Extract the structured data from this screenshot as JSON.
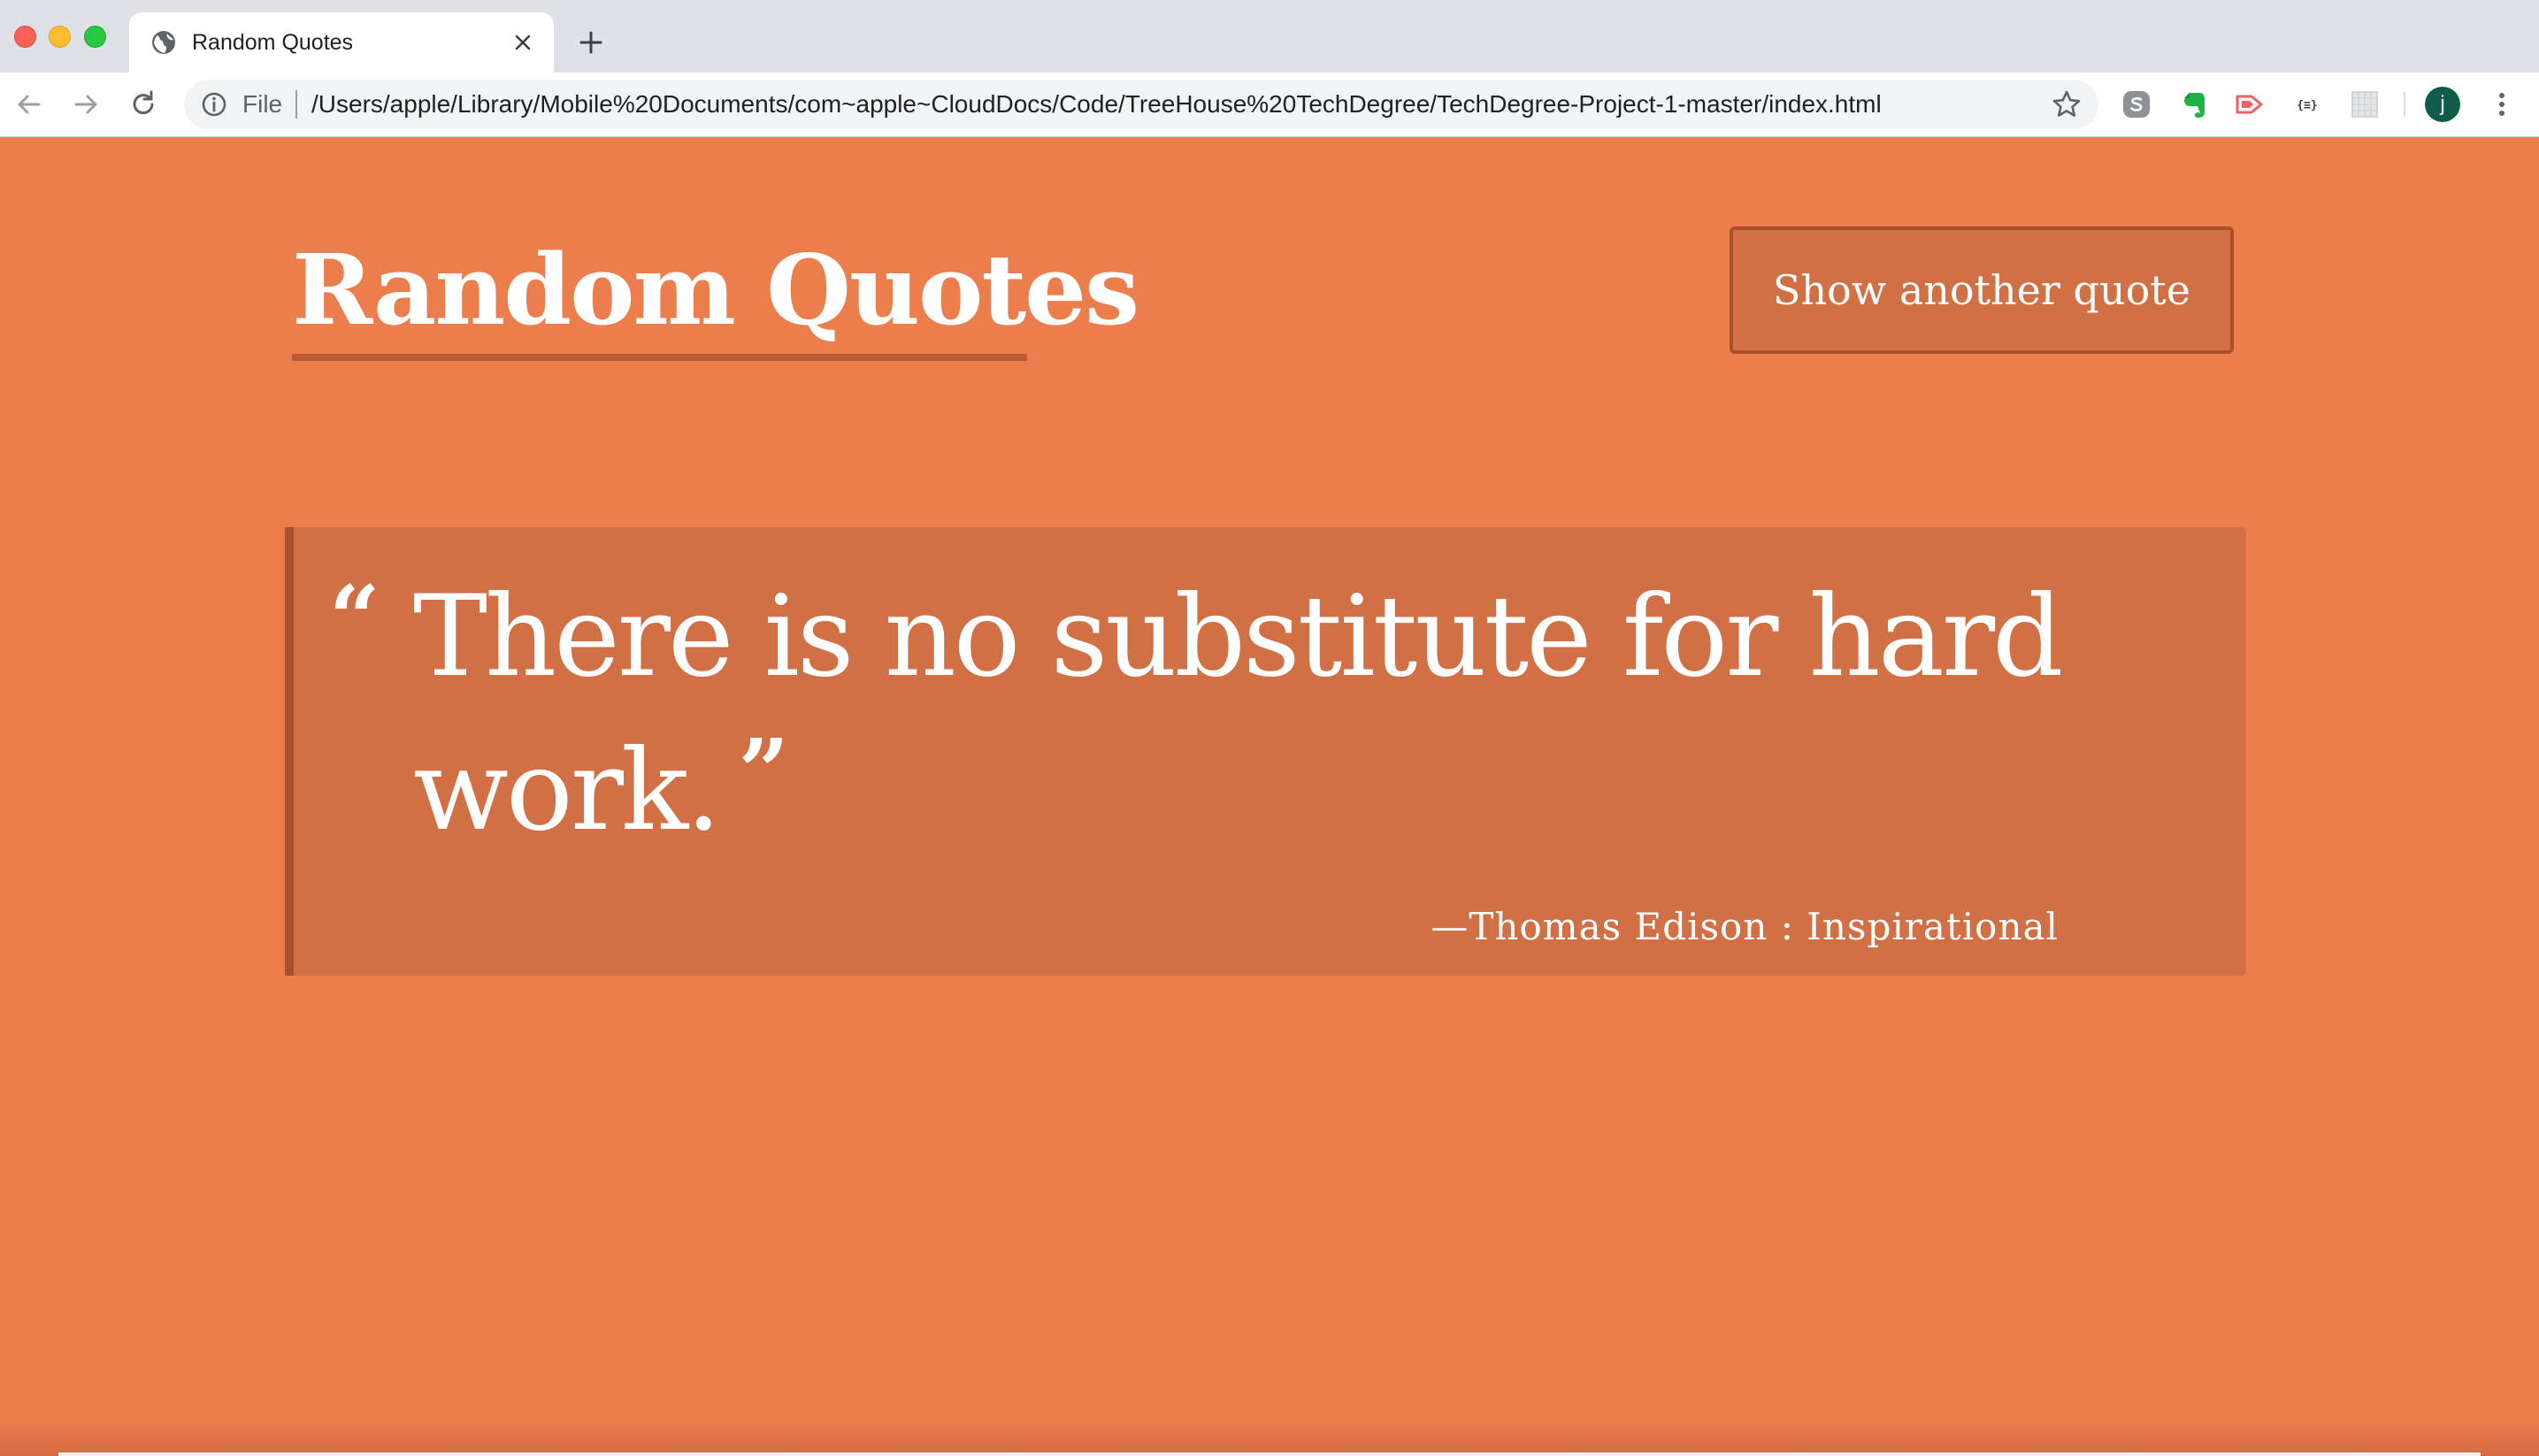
{
  "browser": {
    "tab": {
      "title": "Random Quotes",
      "favicon": "globe-icon"
    },
    "omnibox": {
      "scheme_label": "File",
      "url": "/Users/apple/Library/Mobile%20Documents/com~apple~CloudDocs/Code/TreeHouse%20TechDegree/TechDegree-Project-1-master/index.html"
    },
    "extensions": [
      "skype-icon",
      "evernote-icon",
      "cast-extension-icon",
      "json-formatter-icon",
      "grid-extension-icon"
    ],
    "profile_initial": "j"
  },
  "page": {
    "title": "Random Quotes",
    "button_label": "Show another quote",
    "quote": {
      "open_mark": "“",
      "text": "There is no substitute for hard work.",
      "close_mark": "”",
      "attribution": "—Thomas Edison : Inspirational"
    }
  },
  "colors": {
    "background": "#ec7d4d",
    "quote_box": "#d16f45",
    "accent_border": "#a9502c",
    "text": "#ffffff"
  }
}
